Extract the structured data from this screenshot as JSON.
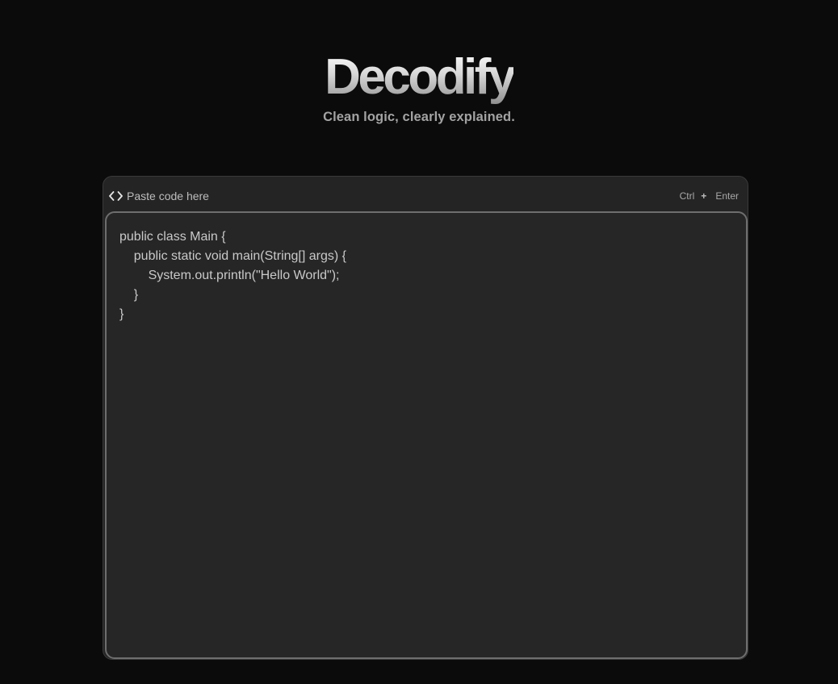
{
  "brand": {
    "title": "Decodify",
    "tagline": "Clean logic, clearly explained."
  },
  "input_panel": {
    "label": "Paste code here",
    "label_icon": "code-brackets-icon",
    "shortcut": {
      "key1": "Ctrl",
      "separator": "+",
      "key2": "Enter"
    },
    "code_value": "public class Main {\n    public static void main(String[] args) {\n        System.out.println(\"Hello World\");\n    }\n}"
  }
}
